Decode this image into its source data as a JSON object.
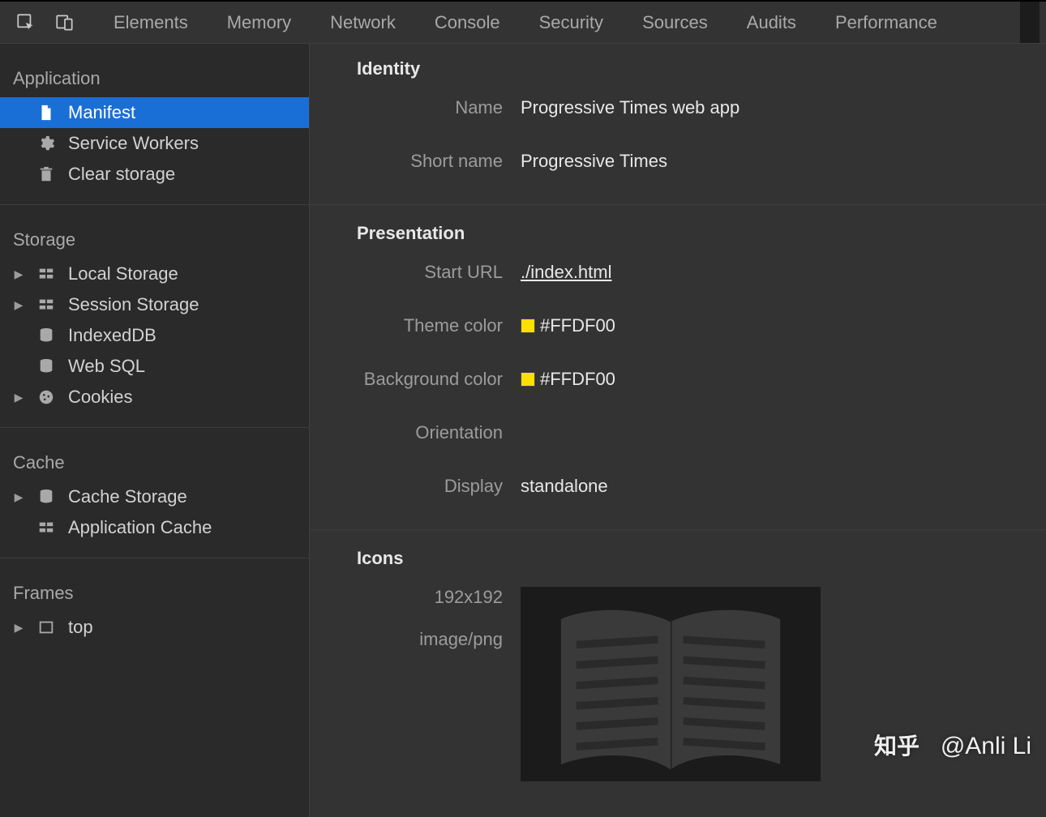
{
  "tabs": {
    "items": [
      "Elements",
      "Memory",
      "Network",
      "Console",
      "Security",
      "Sources",
      "Audits",
      "Performance"
    ]
  },
  "sidebar": {
    "application": {
      "title": "Application",
      "items": [
        {
          "label": "Manifest",
          "icon": "file"
        },
        {
          "label": "Service Workers",
          "icon": "gear"
        },
        {
          "label": "Clear storage",
          "icon": "trash"
        }
      ]
    },
    "storage": {
      "title": "Storage",
      "items": [
        {
          "label": "Local Storage",
          "icon": "grid",
          "expandable": true
        },
        {
          "label": "Session Storage",
          "icon": "grid",
          "expandable": true
        },
        {
          "label": "IndexedDB",
          "icon": "db"
        },
        {
          "label": "Web SQL",
          "icon": "db"
        },
        {
          "label": "Cookies",
          "icon": "cookie",
          "expandable": true
        }
      ]
    },
    "cache": {
      "title": "Cache",
      "items": [
        {
          "label": "Cache Storage",
          "icon": "db",
          "expandable": true
        },
        {
          "label": "Application Cache",
          "icon": "grid"
        }
      ]
    },
    "frames": {
      "title": "Frames",
      "items": [
        {
          "label": "top",
          "icon": "frame",
          "expandable": true
        }
      ]
    }
  },
  "manifest": {
    "identity": {
      "title": "Identity",
      "name_label": "Name",
      "name_value": "Progressive Times web app",
      "shortname_label": "Short name",
      "shortname_value": "Progressive Times"
    },
    "presentation": {
      "title": "Presentation",
      "starturl_label": "Start URL",
      "starturl_value": "./index.html",
      "theme_label": "Theme color",
      "theme_value": "#FFDF00",
      "bg_label": "Background color",
      "bg_value": "#FFDF00",
      "orientation_label": "Orientation",
      "orientation_value": "",
      "display_label": "Display",
      "display_value": "standalone"
    },
    "icons": {
      "title": "Icons",
      "size": "192x192",
      "mime": "image/png"
    }
  },
  "watermark": "知乎 @Anli Li"
}
